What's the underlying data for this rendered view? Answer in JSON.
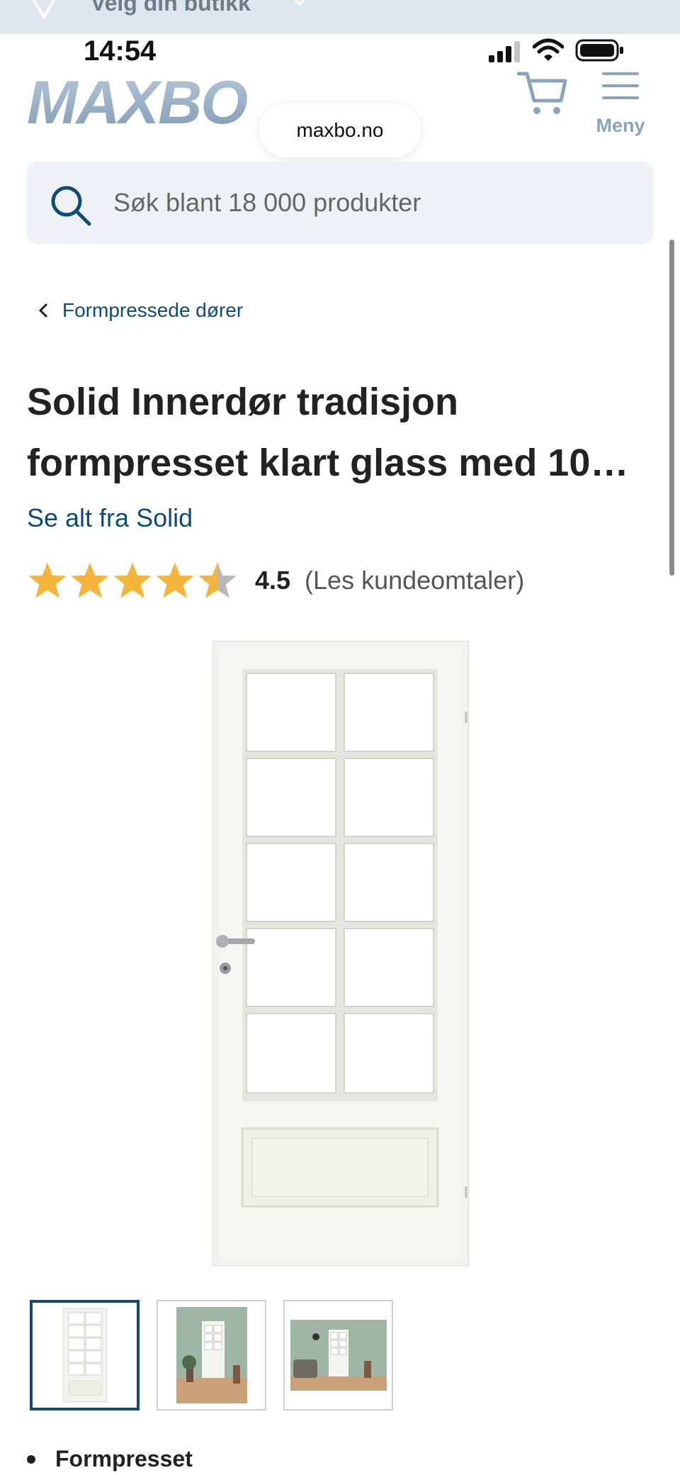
{
  "store_bar": {
    "label": "Velg din butikk"
  },
  "status_bar": {
    "time": "14:54"
  },
  "header": {
    "logo_text": "MAXBO",
    "url": "maxbo.no",
    "menu_label": "Meny"
  },
  "search": {
    "placeholder": "Søk blant 18 000 produkter"
  },
  "breadcrumb": {
    "label": "Formpressede dører"
  },
  "product": {
    "title": "Solid Innerdør tradisjon formpresset klart glass med 10…",
    "brand_link": "Se alt fra Solid",
    "rating_value": 4.5,
    "rating_label": "4.5",
    "reviews_label": "(Les  kundeomtaler)"
  },
  "thumbnails": {
    "count": 3,
    "active_index": 0
  },
  "features": [
    "Formpresset"
  ],
  "colors": {
    "brand_blue": "#0f4c75",
    "star_gold": "#f5b43b",
    "star_gray": "#b8b8b8",
    "logo_blue": "#9fb6cb"
  },
  "icons": [
    "location-pin-icon",
    "chevron-down-icon",
    "cart-icon",
    "hamburger-menu-icon",
    "search-icon",
    "chevron-left-icon",
    "star-icon"
  ]
}
